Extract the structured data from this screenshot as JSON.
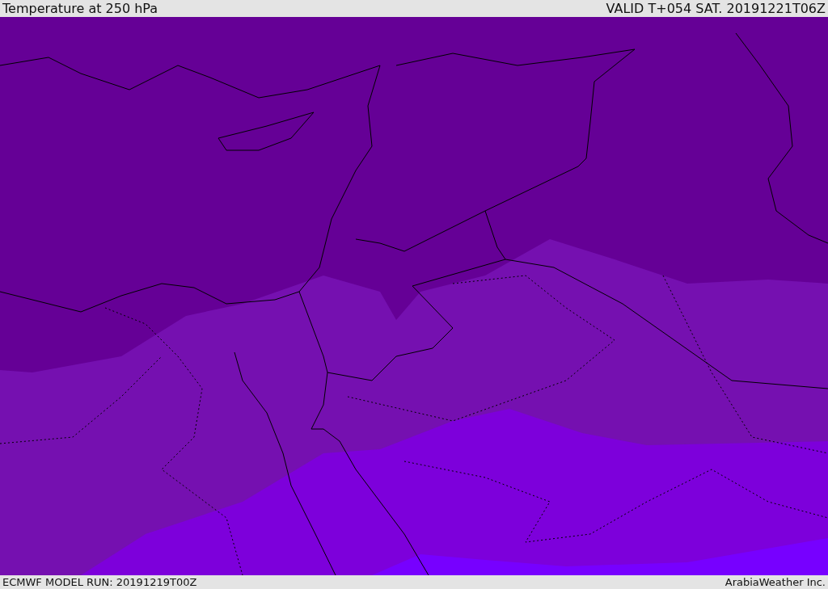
{
  "header": {
    "title": "Temperature at 250 hPa",
    "valid_time": "VALID T+054 SAT. 20191221T06Z"
  },
  "footer": {
    "model_run": "ECMWF MODEL RUN: 20191219T00Z",
    "credit": "ArabiaWeather Inc."
  }
}
